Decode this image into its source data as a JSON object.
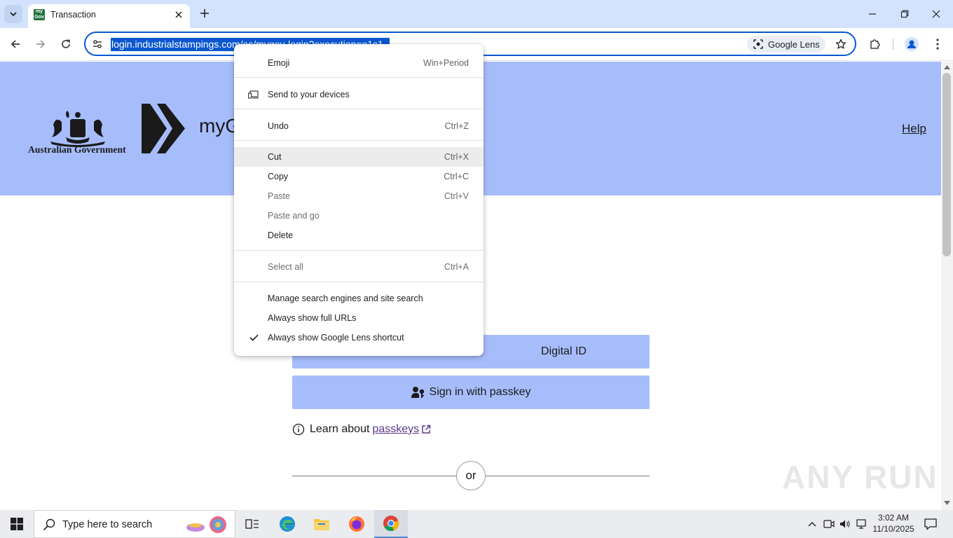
{
  "browser": {
    "tab_title": "Transaction",
    "url": "login.industrialstampings.com/as/mygov-login?execution=e1s1",
    "lens_label": "Google Lens"
  },
  "page": {
    "gov_label": "Australian Government",
    "brand_text": "myG",
    "help_label": "Help",
    "digital_id_label": "Digital ID",
    "passkey_label": "Sign in with passkey",
    "learn_prefix": "Learn about",
    "learn_link": "passkeys",
    "or_label": "or",
    "watermark": "ANY RUN"
  },
  "context_menu": {
    "items": [
      {
        "label": "Emoji",
        "accel": "Win+Period"
      },
      {
        "label": "Send to your devices",
        "accel": ""
      },
      {
        "label": "Undo",
        "accel": "Ctrl+Z"
      },
      {
        "label": "Cut",
        "accel": "Ctrl+X"
      },
      {
        "label": "Copy",
        "accel": "Ctrl+C"
      },
      {
        "label": "Paste",
        "accel": "Ctrl+V"
      },
      {
        "label": "Paste and go",
        "accel": ""
      },
      {
        "label": "Delete",
        "accel": ""
      },
      {
        "label": "Select all",
        "accel": "Ctrl+A"
      },
      {
        "label": "Manage search engines and site search",
        "accel": ""
      },
      {
        "label": "Always show full URLs",
        "accel": ""
      },
      {
        "label": "Always show Google Lens shortcut",
        "accel": ""
      }
    ]
  },
  "taskbar": {
    "search_placeholder": "Type here to search",
    "time": "3:02 AM",
    "date": "11/10/2025"
  },
  "colors": {
    "header_band": "#a7bdfb",
    "tabstrip": "#d3e3fd",
    "accent": "#0b57d0"
  }
}
